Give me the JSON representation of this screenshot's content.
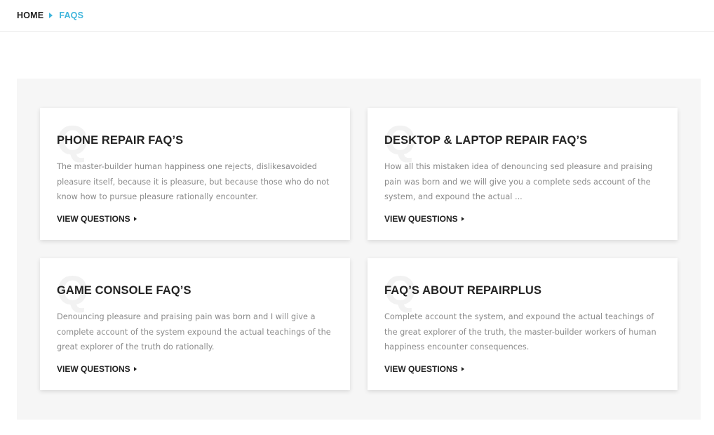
{
  "breadcrumb": {
    "home_label": "HOME",
    "current_label": "FAQS",
    "accent_color": "#3fb5dc"
  },
  "faq_cards": [
    {
      "title": "PHONE REPAIR FAQ’S",
      "text": "The master-builder human happiness one rejects, dislikesavoided pleasure itself, because it is pleasure, but because those who do not know how to pursue pleasure rationally encounter.",
      "link_label": "VIEW QUESTIONS"
    },
    {
      "title": "DESKTOP & LAPTOP REPAIR FAQ’S",
      "text": "How all this mistaken idea of denouncing sed pleasure and praising pain was born and we will give you a complete seds account of the system, and expound the actual ...",
      "link_label": "VIEW QUESTIONS"
    },
    {
      "title": "GAME CONSOLE FAQ’S",
      "text": "Denouncing pleasure and praising pain was born and I will give a complete account of the system expound the actual teachings of the great explorer of the truth do rationally.",
      "link_label": "VIEW QUESTIONS"
    },
    {
      "title": "FAQ’S ABOUT REPAIRPLUS",
      "text": "Complete account the system, and expound the actual teachings of the great explorer of the truth, the master-builder workers of human happiness encounter consequences.",
      "link_label": "VIEW QUESTIONS"
    }
  ],
  "card_watermark": "Q"
}
